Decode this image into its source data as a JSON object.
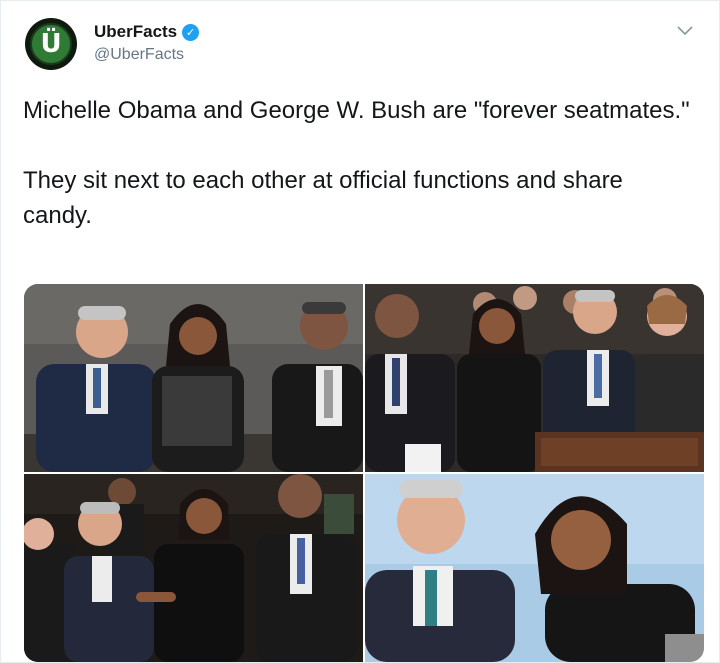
{
  "account": {
    "display_name": "UberFacts",
    "handle": "@UberFacts",
    "avatar_letter": "Ü",
    "verified": true,
    "verified_icon": "verified-badge-icon",
    "menu_icon": "chevron-down-icon"
  },
  "tweet": {
    "paragraph_1": "Michelle Obama and George W. Bush are \"forever seatmates.\"",
    "paragraph_2": "They sit next to each other at official functions and share candy."
  },
  "media": {
    "photos": [
      "photo-1",
      "photo-2",
      "photo-3",
      "photo-4"
    ]
  },
  "colors": {
    "verified_blue": "#1da1f2",
    "avatar_green": "#2f7a35",
    "secondary_text": "#657786",
    "border": "#e6ecf0"
  }
}
